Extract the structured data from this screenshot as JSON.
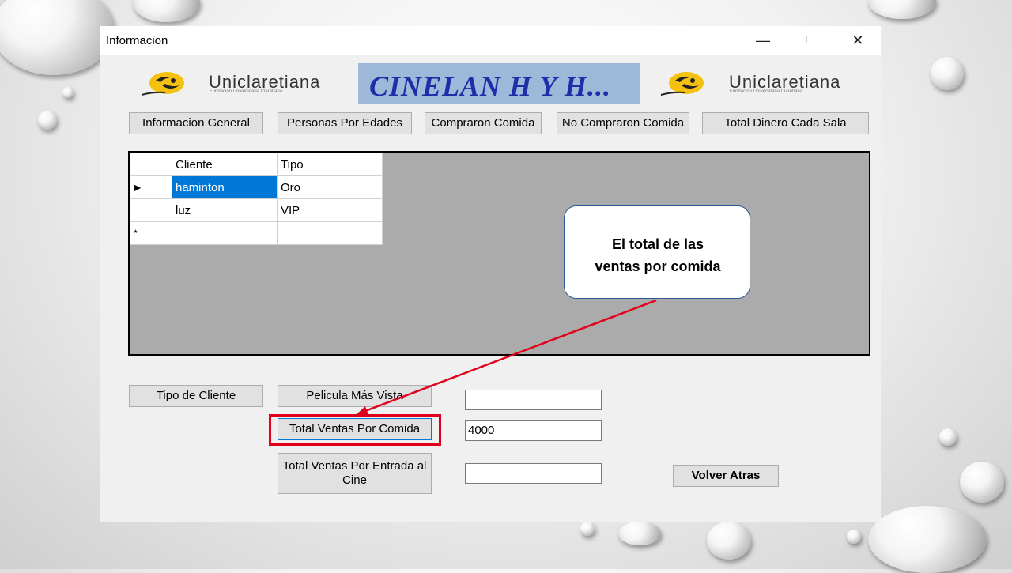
{
  "window": {
    "title": "Informacion",
    "controls": [
      "—",
      "□",
      "✕"
    ]
  },
  "logos": {
    "left_text": "Uniclaretiana",
    "left_sub": "Fundación Universitaria Claretiana",
    "right_text": "Uniclaretiana",
    "right_sub": "Fundación Universitaria Claretiana"
  },
  "banner": {
    "text": "CINELAN H Y H..."
  },
  "nav": {
    "informacion_general": "Informacion General",
    "personas_por_edades": "Personas Por Edades",
    "compraron_comida": "Compraron Comida",
    "no_compraron_comida": "No Compraron Comida",
    "total_dinero_cada_sala": "Total Dinero Cada Sala"
  },
  "grid": {
    "columns": [
      "Cliente",
      "Tipo"
    ],
    "rows": [
      {
        "indicator": "▶",
        "cliente": "haminton",
        "tipo": "Oro"
      },
      {
        "indicator": "",
        "cliente": "luz",
        "tipo": "VIP"
      },
      {
        "indicator": "*",
        "cliente": "",
        "tipo": ""
      }
    ]
  },
  "actions": {
    "tipo_de_cliente": "Tipo de Cliente",
    "pelicula_mas_vista": "Pelicula Más Vista",
    "total_ventas_por_comida": "Total Ventas Por Comida",
    "total_ventas_por_entrada": "Total Ventas Por Entrada al Cine",
    "volver_atras": "Volver Atras"
  },
  "fields": {
    "pelicula_mas_vista": "",
    "total_ventas_comida": "4000",
    "total_ventas_entrada": ""
  },
  "callout": {
    "line1": "El total de las",
    "line2": "ventas por comida"
  },
  "colors": {
    "highlight": "#e0001b",
    "callout_border": "#2f5597",
    "banner_bg": "#9db8d9",
    "banner_text": "#1d2fa8",
    "selection": "#0078d7"
  },
  "icons": {
    "logo": "sun-logo-icon",
    "row_indicator": "row-pointer-icon"
  }
}
